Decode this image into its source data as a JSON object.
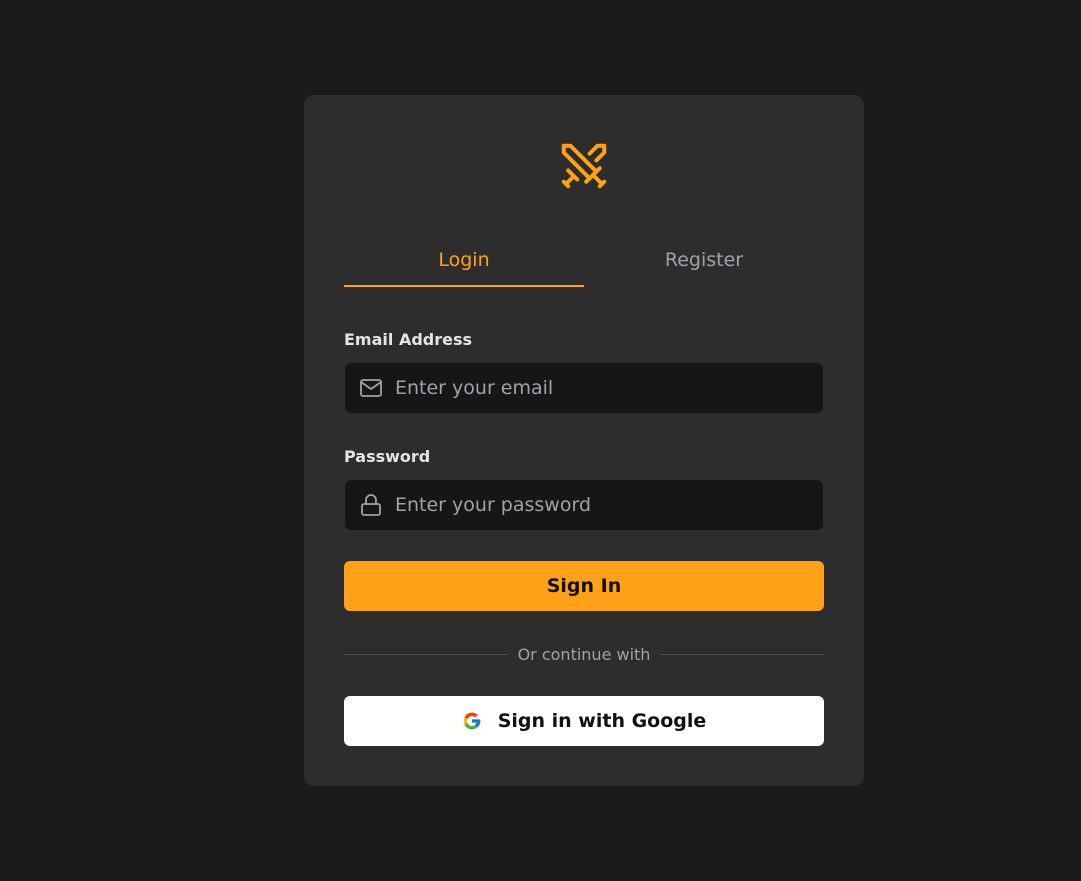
{
  "colors": {
    "accent": "#ffa21a",
    "page_background": "#1b1b1b",
    "card_background": "#2d2d2d",
    "input_background": "#161616"
  },
  "logo": {
    "icon": "crossed-swords-icon"
  },
  "tabs": [
    {
      "label": "Login",
      "active": true
    },
    {
      "label": "Register",
      "active": false
    }
  ],
  "email": {
    "label": "Email Address",
    "placeholder": "Enter your email",
    "value": "",
    "icon": "mail-icon"
  },
  "password": {
    "label": "Password",
    "placeholder": "Enter your password",
    "value": "",
    "icon": "lock-icon"
  },
  "sign_in_label": "Sign In",
  "divider_text": "Or continue with",
  "google": {
    "label": "Sign in with Google",
    "icon": "google-icon"
  }
}
